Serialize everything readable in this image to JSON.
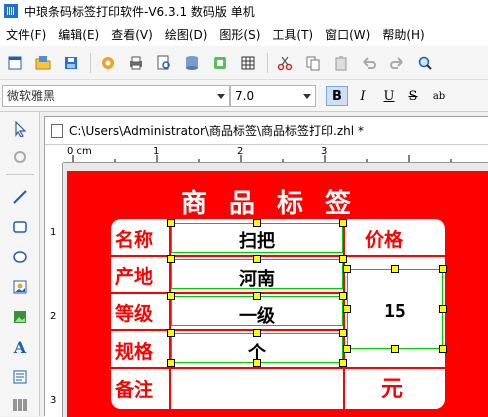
{
  "window": {
    "title": "中琅条码标签打印软件-V6.3.1 数码版 单机"
  },
  "menu": [
    "文件(F)",
    "编辑(E)",
    "查看(V)",
    "绘图(D)",
    "图形(S)",
    "工具(T)",
    "窗口(W)",
    "帮助(H)"
  ],
  "toolbar": {
    "icons": [
      "new-icon",
      "open-icon",
      "save-icon",
      "settings-icon",
      "print-icon",
      "print-preview-icon",
      "database-icon",
      "data-source-icon",
      "grid-icon",
      "cut-icon",
      "copy-icon",
      "paste-icon",
      "undo-icon",
      "redo-icon",
      "zoom-icon"
    ]
  },
  "fontbar": {
    "font_name": "微软雅黑",
    "font_size": "7.0",
    "bold": "B",
    "italic": "I",
    "underline": "U",
    "strike": "S",
    "spacing": "ab"
  },
  "document": {
    "tab_title": "C:\\Users\\Administrator\\商品标签\\商品标签打印.zhl *"
  },
  "ruler": {
    "unit_label": "0 cm",
    "h_ticks": [
      "1",
      "2",
      "3"
    ],
    "v_ticks": [
      "1",
      "2",
      "3"
    ]
  },
  "label": {
    "title": "商品标签",
    "fields": [
      {
        "name": "名称",
        "value": "扫把"
      },
      {
        "name": "产地",
        "value": "河南"
      },
      {
        "name": "等级",
        "value": "一级"
      },
      {
        "name": "规格",
        "value": "个"
      },
      {
        "name": "备注",
        "value": ""
      }
    ],
    "price_label": "价格",
    "price_value": "15",
    "currency": "元"
  },
  "colors": {
    "label_bg": "#ff0000",
    "handle": "#ffff00",
    "selection": "#00cc00"
  }
}
